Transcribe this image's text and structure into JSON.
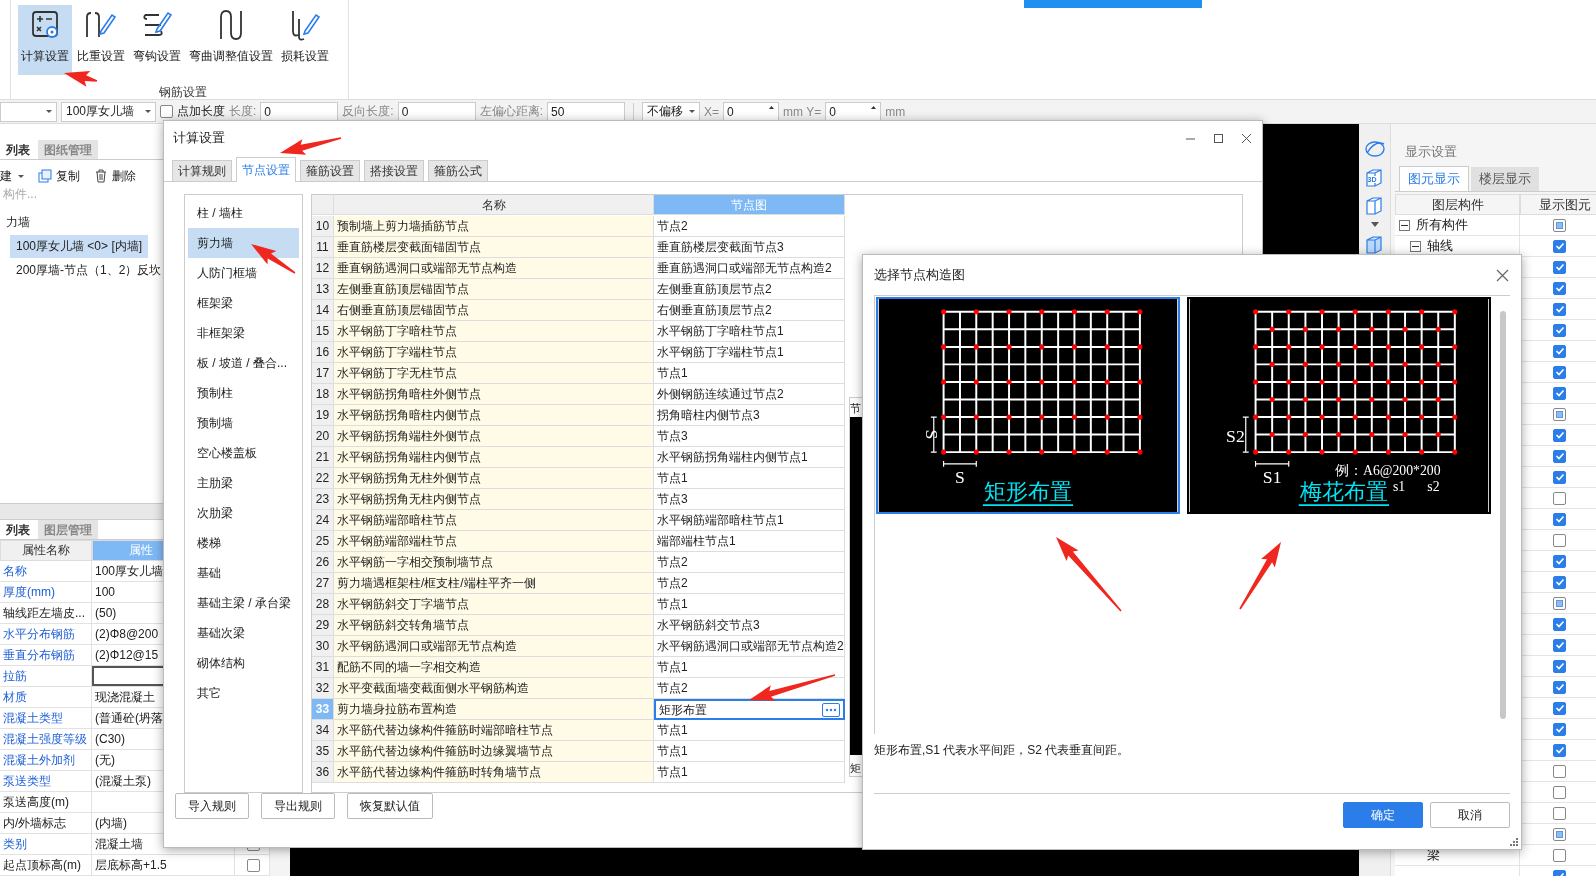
{
  "ribbon": {
    "buttons": [
      {
        "label": "计算设置",
        "selected": true
      },
      {
        "label": "比重设置",
        "selected": false
      },
      {
        "label": "弯钩设置",
        "selected": false
      },
      {
        "label": "弯曲调整值设置",
        "selected": false
      },
      {
        "label": "损耗设置",
        "selected": false
      }
    ],
    "group_label": "钢筋设置"
  },
  "prop_toolbar": {
    "wall_dropdown": "100厚女儿墙",
    "add_length": {
      "label": "点加长度",
      "checked": false
    },
    "fields": [
      {
        "label": "长度:",
        "value": "0"
      },
      {
        "label": "反向长度:",
        "value": "0"
      },
      {
        "label": "左偏心距离:",
        "value": "50"
      }
    ],
    "offset_dropdown": "不偏移",
    "coords": [
      {
        "label": "X=",
        "value": "0"
      },
      {
        "label": "mm Y=",
        "value": "0"
      }
    ],
    "unit": "mm"
  },
  "left_panel": {
    "tabs": [
      {
        "label": "列表",
        "selected": true
      },
      {
        "label": "图纸管理",
        "selected": false
      }
    ],
    "actions": [
      {
        "label": "建",
        "kind": "dropdown"
      },
      {
        "label": "复制",
        "kind": "copy"
      },
      {
        "label": "删除",
        "kind": "delete"
      }
    ],
    "search": {
      "placeholder": "构件..."
    },
    "tree": [
      {
        "label": "力墙",
        "children": [
          {
            "label": "100厚女儿墙 <0> [内墙]",
            "selected": true
          },
          {
            "label": "200厚墙-节点（1、2）反坎",
            "selected": false
          }
        ]
      }
    ]
  },
  "props_panel": {
    "tabs": [
      {
        "label": "列表",
        "selected": true
      },
      {
        "label": "图层管理",
        "selected": false
      }
    ],
    "columns": [
      "属性名称",
      "属性"
    ],
    "rows": [
      {
        "name": "名称",
        "value": "100厚女儿墙",
        "public": true
      },
      {
        "name": "厚度(mm)",
        "value": "100",
        "public": true
      },
      {
        "name": "轴线距左墙皮...",
        "value": "(50)",
        "public": false
      },
      {
        "name": "水平分布钢筋",
        "value": "(2)Φ8@200",
        "public": true
      },
      {
        "name": "垂直分布钢筋",
        "value": "(2)Φ12@15",
        "public": true
      },
      {
        "name": "拉筋",
        "value": "",
        "public": true,
        "editing": true
      },
      {
        "name": "材质",
        "value": "现浇混凝土",
        "public": true
      },
      {
        "name": "混凝土类型",
        "value": "(普通砼(坍落",
        "public": true
      },
      {
        "name": "混凝土强度等级",
        "value": "(C30)",
        "public": true
      },
      {
        "name": "混凝土外加剂",
        "value": "(无)",
        "public": true
      },
      {
        "name": "泵送类型",
        "value": "(混凝土泵)",
        "public": true
      },
      {
        "name": "泵送高度(m)",
        "value": "",
        "public": false
      },
      {
        "name": "内/外墙标志",
        "value": "(内墙)",
        "public": false
      },
      {
        "name": "类别",
        "value": "混凝土墙",
        "public": true,
        "attached": false
      },
      {
        "name": "起点顶标高(m)",
        "value": "层底标高+1.5",
        "public": false,
        "attached": false
      }
    ]
  },
  "view_tools": [
    {
      "kind": "orbit"
    },
    {
      "kind": "cube3d",
      "label": "3D"
    },
    {
      "kind": "cube"
    },
    {
      "kind": "caret"
    },
    {
      "kind": "cube_blue"
    }
  ],
  "display_panel": {
    "title": "显示设置",
    "tabs": [
      {
        "label": "图元显示",
        "selected": true
      },
      {
        "label": "楼层显示",
        "selected": false
      }
    ],
    "columns": [
      "图层构件",
      "显示图元"
    ],
    "layers": [
      {
        "name": "所有构件",
        "expanded": true,
        "checked": false,
        "mixed": true,
        "children": [
          {
            "name": "轴线",
            "expanded": true,
            "checked": true
          },
          {
            "checked": true
          },
          {
            "checked": true
          },
          {
            "checked": true
          },
          {
            "checked": true
          },
          {
            "checked": true
          },
          {
            "checked": true
          },
          {
            "checked": true
          },
          {
            "checked": false,
            "mixed": true
          },
          {
            "checked": true
          },
          {
            "checked": true
          },
          {
            "checked": true
          },
          {
            "checked": false
          },
          {
            "checked": true
          },
          {
            "checked": false
          },
          {
            "checked": true
          },
          {
            "checked": true
          },
          {
            "checked": false,
            "mixed": true
          },
          {
            "checked": true
          },
          {
            "checked": true
          },
          {
            "checked": true
          },
          {
            "checked": true
          },
          {
            "checked": true
          },
          {
            "checked": true
          },
          {
            "checked": true
          },
          {
            "checked": false
          },
          {
            "checked": false
          },
          {
            "checked": false
          },
          {
            "checked": false,
            "mixed": true
          },
          {
            "name": "梁",
            "checked": false
          },
          {
            "checked": true
          }
        ]
      }
    ]
  },
  "calc_dialog": {
    "title": "计算设置",
    "tabs": [
      {
        "label": "计算规则",
        "selected": false
      },
      {
        "label": "节点设置",
        "selected": true
      },
      {
        "label": "箍筋设置",
        "selected": false
      },
      {
        "label": "搭接设置",
        "selected": false
      },
      {
        "label": "箍筋公式",
        "selected": false
      }
    ],
    "categories": [
      {
        "label": "柱 / 墙柱",
        "selected": false
      },
      {
        "label": "剪力墙",
        "selected": true
      },
      {
        "label": "人防门框墙",
        "selected": false
      },
      {
        "label": "框架梁",
        "selected": false
      },
      {
        "label": "非框架梁",
        "selected": false
      },
      {
        "label": "板 / 坡道 / 叠合...",
        "selected": false
      },
      {
        "label": "预制柱",
        "selected": false
      },
      {
        "label": "预制墙",
        "selected": false
      },
      {
        "label": "空心楼盖板",
        "selected": false
      },
      {
        "label": "主肋梁",
        "selected": false
      },
      {
        "label": "次肋梁",
        "selected": false
      },
      {
        "label": "楼梯",
        "selected": false
      },
      {
        "label": "基础",
        "selected": false
      },
      {
        "label": "基础主梁 / 承台梁",
        "selected": false
      },
      {
        "label": "基础次梁",
        "selected": false
      },
      {
        "label": "砌体结构",
        "selected": false
      },
      {
        "label": "其它",
        "selected": false
      }
    ],
    "table": {
      "columns": [
        {
          "label": "名称",
          "selected": false
        },
        {
          "label": "节点图",
          "selected": true
        }
      ],
      "rows": [
        {
          "no": "10",
          "name": "预制墙上剪力墙插筋节点",
          "node": "节点2",
          "selected": false
        },
        {
          "no": "11",
          "name": "垂直筋楼层变截面锚固节点",
          "node": "垂直筋楼层变截面节点3",
          "selected": false
        },
        {
          "no": "12",
          "name": "垂直钢筋遇洞口或端部无节点构造",
          "node": "垂直筋遇洞口或端部无节点构造2",
          "selected": false
        },
        {
          "no": "13",
          "name": "左侧垂直筋顶层锚固节点",
          "node": "左侧垂直筋顶层节点2",
          "selected": false
        },
        {
          "no": "14",
          "name": "右侧垂直筋顶层锚固节点",
          "node": "右侧垂直筋顶层节点2",
          "selected": false
        },
        {
          "no": "15",
          "name": "水平钢筋丁字暗柱节点",
          "node": "水平钢筋丁字暗柱节点1",
          "selected": false
        },
        {
          "no": "16",
          "name": "水平钢筋丁字端柱节点",
          "node": "水平钢筋丁字端柱节点1",
          "selected": false
        },
        {
          "no": "17",
          "name": "水平钢筋丁字无柱节点",
          "node": "节点1",
          "selected": false
        },
        {
          "no": "18",
          "name": "水平钢筋拐角暗柱外侧节点",
          "node": "外侧钢筋连续通过节点2",
          "selected": false
        },
        {
          "no": "19",
          "name": "水平钢筋拐角暗柱内侧节点",
          "node": "拐角暗柱内侧节点3",
          "selected": false
        },
        {
          "no": "20",
          "name": "水平钢筋拐角端柱外侧节点",
          "node": "节点3",
          "selected": false
        },
        {
          "no": "21",
          "name": "水平钢筋拐角端柱内侧节点",
          "node": "水平钢筋拐角端柱内侧节点1",
          "selected": false
        },
        {
          "no": "22",
          "name": "水平钢筋拐角无柱外侧节点",
          "node": "节点1",
          "selected": false
        },
        {
          "no": "23",
          "name": "水平钢筋拐角无柱内侧节点",
          "node": "节点3",
          "selected": false
        },
        {
          "no": "24",
          "name": "水平钢筋端部暗柱节点",
          "node": "水平钢筋端部暗柱节点1",
          "selected": false
        },
        {
          "no": "25",
          "name": "水平钢筋端部端柱节点",
          "node": "端部端柱节点1",
          "selected": false
        },
        {
          "no": "26",
          "name": "水平钢筋一字相交预制墙节点",
          "node": "节点2",
          "selected": false
        },
        {
          "no": "27",
          "name": "剪力墙遇框架柱/框支柱/端柱平齐一侧",
          "node": "节点2",
          "selected": false
        },
        {
          "no": "28",
          "name": "水平钢筋斜交丁字墙节点",
          "node": "节点1",
          "selected": false
        },
        {
          "no": "29",
          "name": "水平钢筋斜交转角墙节点",
          "node": "水平钢筋斜交节点3",
          "selected": false
        },
        {
          "no": "30",
          "name": "水平钢筋遇洞口或端部无节点构造",
          "node": "水平钢筋遇洞口或端部无节点构造2",
          "selected": false
        },
        {
          "no": "31",
          "name": "配筋不同的墙一字相交构造",
          "node": "节点1",
          "selected": false
        },
        {
          "no": "32",
          "name": "水平变截面墙变截面侧水平钢筋构造",
          "node": "节点2",
          "selected": false
        },
        {
          "no": "33",
          "name": "剪力墙身拉筋布置构造",
          "node": "矩形布置",
          "selected": true
        },
        {
          "no": "34",
          "name": "水平筋代替边缘构件箍筋时端部暗柱节点",
          "node": "节点1",
          "selected": false
        },
        {
          "no": "35",
          "name": "水平筋代替边缘构件箍筋时边缘翼墙节点",
          "node": "节点1",
          "selected": false
        },
        {
          "no": "36",
          "name": "水平筋代替边缘构件箍筋时转角墙节点",
          "node": "节点1",
          "selected": false
        }
      ]
    },
    "preview": {
      "title": "节",
      "caption": "矩"
    },
    "buttons": [
      "导入规则",
      "导出规则",
      "恢复默认值"
    ]
  },
  "node_dialog": {
    "title": "选择节点构造图",
    "options": [
      {
        "kind": "rect",
        "title": "矩形布置",
        "dim_v": "S",
        "dim_h": "S",
        "selected": true
      },
      {
        "kind": "quincunx",
        "title": "梅花布置",
        "dim_v": "S2",
        "dim_h": "S1",
        "example": "例：A6@200*200",
        "sub1": "s1",
        "sub2": "s2",
        "selected": false
      }
    ],
    "description": "矩形布置,S1 代表水平间距，S2 代表垂直间距。",
    "buttons": [
      {
        "label": "确定",
        "primary": true
      },
      {
        "label": "取消",
        "primary": false
      }
    ]
  }
}
